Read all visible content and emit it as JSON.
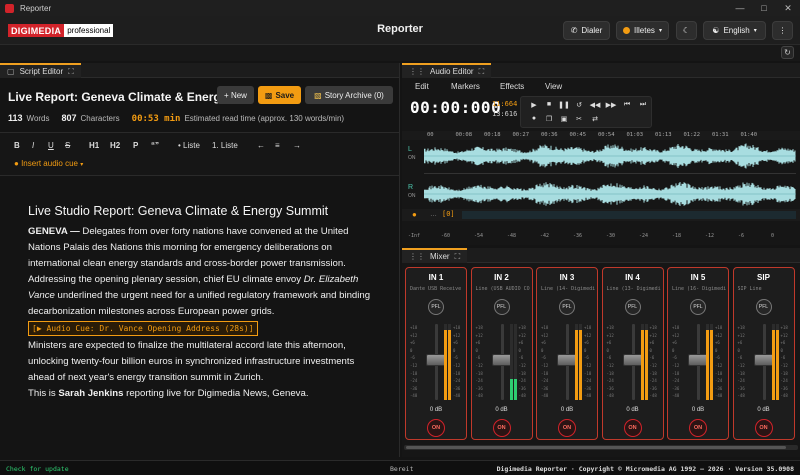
{
  "window": {
    "title": "Reporter"
  },
  "header": {
    "brand_red": "DIGIMEDIA",
    "brand_white": "professional",
    "title": "Reporter",
    "dialer_label": "Dialer",
    "user_label": "Illetes",
    "language_label": "English"
  },
  "editor": {
    "tab_label": "Script Editor",
    "doc_title": "Live Report: Geneva Climate & Energy",
    "new_label": "+ New",
    "save_label": "Save",
    "archive_label": "Story Archive (0)",
    "stats": {
      "words_value": "113",
      "words_label": "Words",
      "chars_value": "807",
      "chars_label": "Characters",
      "read_time": "00:53 min",
      "read_label": "Estimated read time (approx. 130 words/min)"
    },
    "format": {
      "bold": "B",
      "italic": "I",
      "underline": "U",
      "strike": "S",
      "h1": "H1",
      "h2": "H2",
      "p": "P",
      "quote": "“”",
      "bullet": "• Liste",
      "numbered": "1. Liste",
      "align_left": "←",
      "align_center": "≡",
      "align_right": "→",
      "insert_cue": "Insert audio cue"
    },
    "content": {
      "heading": "Live Studio Report: Geneva Climate & Energy Summit",
      "p1_dateline": "GENEVA —",
      "p1_a": " Delegates from over forty nations have convened at the United Nations Palais des Nations this morning for emergency deliberations on international clean energy standards and cross-border power transmission. Addressing the opening plenary session, chief EU climate envoy ",
      "p1_name": "Dr. Elizabeth Vance",
      "p1_b": " underlined the urgent need for a unified regulatory framework and binding decarbonization milestones across European power grids.",
      "cue": "[▶ Audio Cue: Dr. Vance Opening Address (28s)]",
      "p2": "Ministers are expected to finalize the multilateral accord late this afternoon, unlocking twenty-four billion euros in synchronized infrastructure investments ahead of next year's energy transition summit in Zurich.",
      "p3_a": "This is ",
      "p3_name": "Sarah Jenkins",
      "p3_b": " reporting live for Digimedia News, Geneva."
    }
  },
  "audio_editor": {
    "tab_label": "Audio Editor",
    "menus": [
      "Edit",
      "Markers",
      "Effects",
      "View"
    ],
    "timecode": "00:00:000",
    "total_a": "11:664",
    "total_b": "13:616",
    "ruler": [
      "00",
      "00:08",
      "00:18",
      "00:27",
      "00:36",
      "00:45",
      "00:54",
      "01:03",
      "01:13",
      "01:22",
      "01:31",
      "01:40"
    ],
    "track_left": "L",
    "track_right": "R",
    "track_on": "ON",
    "marker_box": "[0]",
    "scale": [
      "-Inf",
      "-60",
      "-54",
      "-48",
      "-42",
      "-36",
      "-30",
      "-24",
      "-18",
      "-12",
      "-6",
      "0"
    ]
  },
  "mixer": {
    "tab_label": "Mixer",
    "channels": [
      {
        "name": "IN 1",
        "source": "Dante USB Receive ...",
        "db": "0 dB",
        "level": 0.0
      },
      {
        "name": "IN 2",
        "source": "Line (USB AUDIO CO...",
        "db": "0 dB",
        "level": 0.28
      },
      {
        "name": "IN 3",
        "source": "Line (14- Digimedi...",
        "db": "0 dB",
        "level": 0.0
      },
      {
        "name": "IN 4",
        "source": "Line (13- Digimedi...",
        "db": "0 dB",
        "level": 0.0
      },
      {
        "name": "IN 5",
        "source": "Line (16- Digimedi...",
        "db": "0 dB",
        "level": 0.0
      },
      {
        "name": "SIP",
        "source": "SIP Line",
        "db": "0 dB",
        "level": 0.0
      }
    ],
    "pfl_label": "PFL",
    "on_label": "ON",
    "scale": [
      "+18",
      "+12",
      "+6",
      "0",
      "-6",
      "-12",
      "-18",
      "-24",
      "-36",
      "-48"
    ]
  },
  "status": {
    "update": "Check for update",
    "state": "Bereit",
    "copyright": "Digimedia Reporter · Copyright © Micromedia AG 1992 – 2026 · Version 35.0908"
  },
  "colors": {
    "accent": "#f39c12",
    "brand": "#d2232a",
    "wave": "#a8dde0",
    "meter": "#f39c12",
    "meter_active": "#2ecc71"
  }
}
